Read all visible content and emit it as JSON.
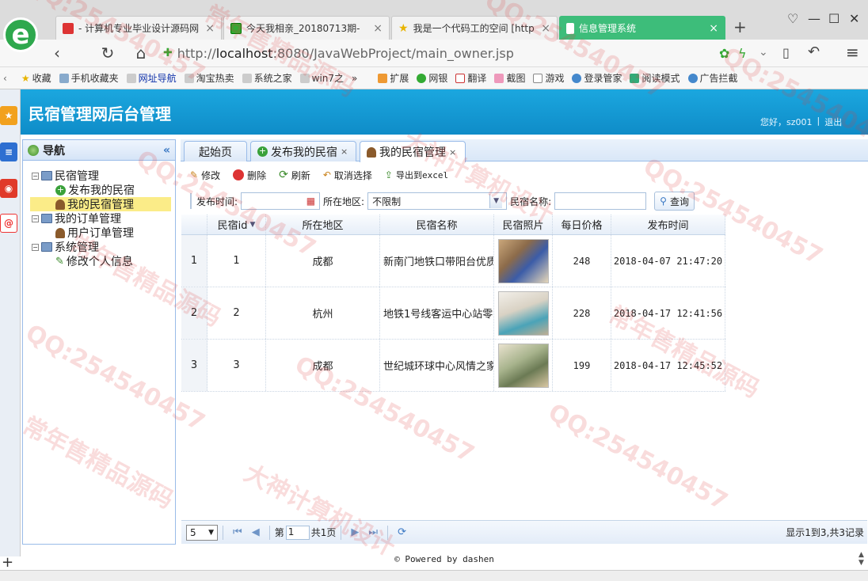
{
  "browser": {
    "tabs": [
      {
        "label": "- 计算机专业毕业设计源码网"
      },
      {
        "label": "今天我相亲_20180713期-"
      },
      {
        "label": "我是一个代码工的空间 [http"
      },
      {
        "label": "信息管理系统",
        "active": true
      }
    ],
    "url_prefix": "http://",
    "url_host": "localhost",
    "url_rest": ":8080/JavaWebProject/main_owner.jsp",
    "bookmarks": [
      "收藏",
      "手机收藏夹",
      "网址导航",
      "淘宝热卖",
      "系统之家",
      "win7之",
      "»",
      "扩展",
      "网银",
      "翻译",
      "截图",
      "游戏",
      "登录管家",
      "阅读模式",
      "广告拦截"
    ]
  },
  "app": {
    "title": "民宿管理网后台管理",
    "greeting": "您好，sz001",
    "separator": "|",
    "logout": "退出"
  },
  "nav": {
    "title": "导航",
    "collapse": "«",
    "tree": [
      {
        "label": "民宿管理",
        "children": [
          {
            "label": "发布我的民宿"
          },
          {
            "label": "我的民宿管理",
            "selected": true
          }
        ]
      },
      {
        "label": "我的订单管理",
        "children": [
          {
            "label": "用户订单管理"
          }
        ]
      },
      {
        "label": "系统管理",
        "children": [
          {
            "label": "修改个人信息"
          }
        ]
      }
    ]
  },
  "tabs": [
    {
      "label": "起始页"
    },
    {
      "label": "发布我的民宿",
      "closable": true
    },
    {
      "label": "我的民宿管理",
      "closable": true,
      "active": true
    }
  ],
  "toolbar": {
    "edit": "修改",
    "delete": "删除",
    "refresh": "刷新",
    "unselect": "取消选择",
    "export": "导出到excel"
  },
  "filters": {
    "publish_time_label": "发布时间:",
    "region_label": "所在地区:",
    "region_value": "不限制",
    "name_label": "民宿名称:",
    "search_button": "查询"
  },
  "grid": {
    "columns": [
      "民宿id",
      "所在地区",
      "民宿名称",
      "民宿照片",
      "每日价格",
      "发布时间"
    ],
    "rows": [
      {
        "rownum": "1",
        "id": "1",
        "region": "成都",
        "name": "新南门地铁口带阳台优质",
        "price": "248",
        "time": "2018-04-07 21:47:20"
      },
      {
        "rownum": "2",
        "id": "2",
        "region": "杭州",
        "name": "地铁1号线客运中心站零",
        "price": "228",
        "time": "2018-04-17 12:41:56"
      },
      {
        "rownum": "3",
        "id": "3",
        "region": "成都",
        "name": "世纪城环球中心风情之家",
        "price": "199",
        "time": "2018-04-17 12:45:52"
      }
    ]
  },
  "pager": {
    "page_size": "5",
    "page_prefix": "第",
    "page_value": "1",
    "page_total": "共1页",
    "summary": "显示1到3,共3记录"
  },
  "footer": {
    "text": "© Powered by dashen"
  },
  "watermarks": [
    "QQ:254540457",
    "常年售精品源码",
    "大神计算机设计"
  ]
}
